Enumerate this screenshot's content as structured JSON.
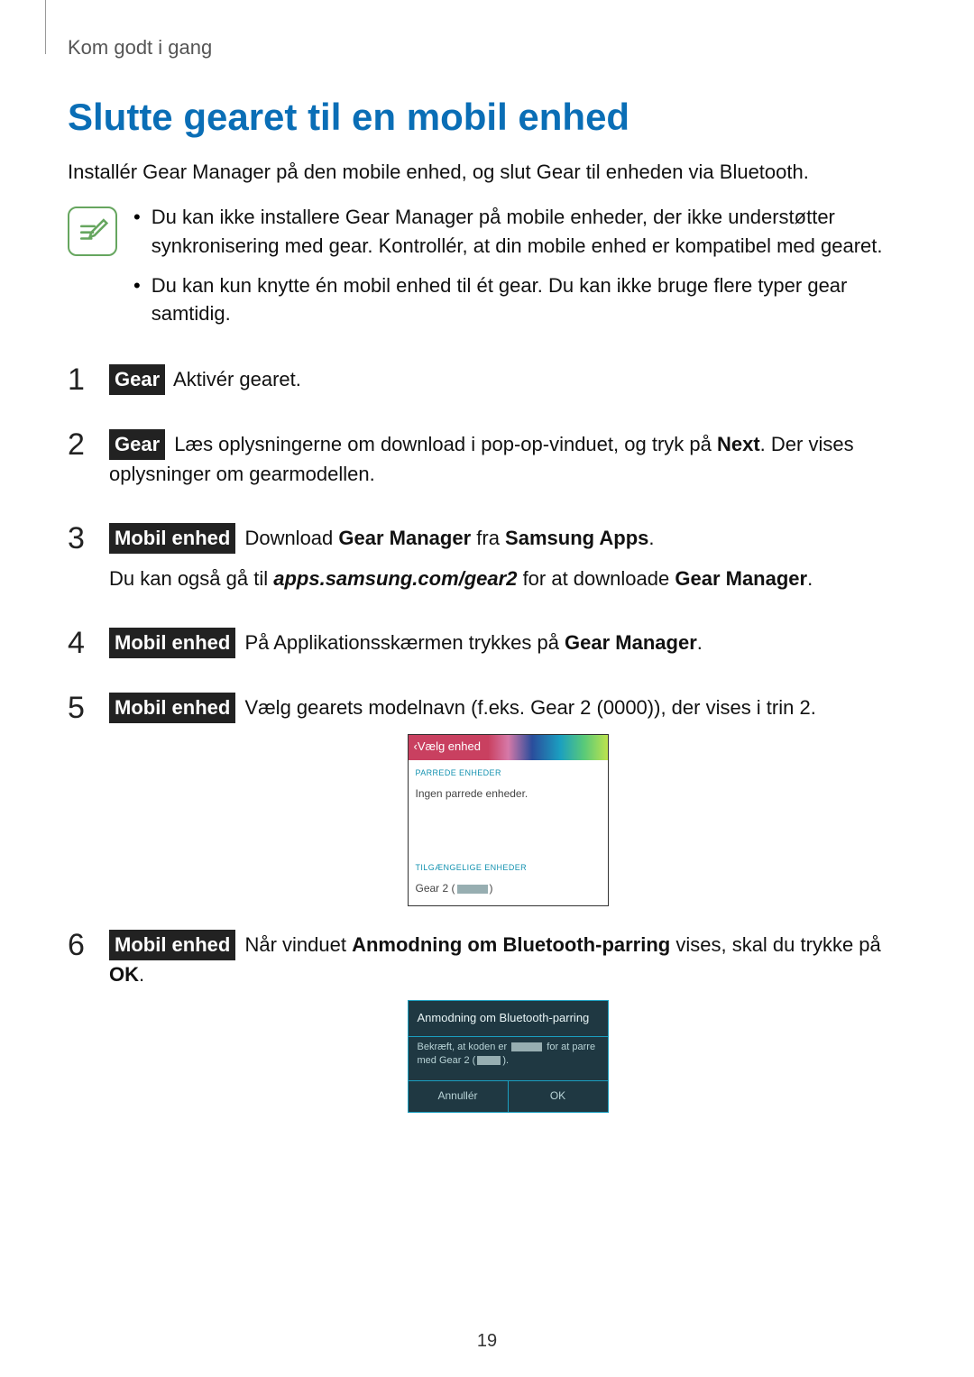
{
  "header": "Kom godt i gang",
  "title": "Slutte gearet til en mobil enhed",
  "intro": "Installér Gear Manager på den mobile enhed, og slut Gear til enheden via Bluetooth.",
  "note_icon": "notes-pencil-icon",
  "notes": [
    "Du kan ikke installere Gear Manager på mobile enheder, der ikke understøtter synkronisering med gear. Kontrollér, at din mobile enhed er kompatibel med gearet.",
    "Du kan kun knytte én mobil enhed til ét gear. Du kan ikke bruge flere typer gear samtidig."
  ],
  "tags": {
    "gear": "Gear",
    "mobile": "Mobil enhed"
  },
  "steps": {
    "s1": {
      "num": "1",
      "text": " Aktivér gearet."
    },
    "s2": {
      "num": "2",
      "t1": " Læs oplysningerne om download i pop-op-vinduet, og tryk på ",
      "b1": "Next",
      "t2": ". Der vises oplysninger om gearmodellen."
    },
    "s3": {
      "num": "3",
      "t1": " Download ",
      "b1": "Gear Manager",
      "t2": " fra ",
      "b2": "Samsung Apps",
      "t3": ".",
      "p2a": "Du kan også gå til ",
      "link": "apps.samsung.com/gear2",
      "p2b": " for at downloade ",
      "b3": "Gear Manager",
      "p2c": "."
    },
    "s4": {
      "num": "4",
      "t1": " På Applikationsskærmen trykkes på ",
      "b1": "Gear Manager",
      "t2": "."
    },
    "s5": {
      "num": "5",
      "t1": " Vælg gearets modelnavn (f.eks. Gear 2 (0000)), der vises i trin 2."
    },
    "s6": {
      "num": "6",
      "t1": " Når vinduet ",
      "b1": "Anmodning om Bluetooth-parring",
      "t2": " vises, skal du trykke på ",
      "b2": "OK",
      "t3": "."
    }
  },
  "device_screen": {
    "title_chevron": "‹ ",
    "title": "Vælg enhed",
    "paired_label": "PARREDE ENHEDER",
    "paired_none": "Ingen parrede enheder.",
    "available_label": "TILGÆNGELIGE ENHEDER",
    "available_pre": "Gear 2 (",
    "available_post": ")"
  },
  "dialog": {
    "title": "Anmodning om Bluetooth-parring",
    "body_a": "Bekræft, at koden er ",
    "body_b": " for at parre med Gear 2 (",
    "body_c": ").",
    "cancel": "Annullér",
    "ok": "OK"
  },
  "page_number": "19"
}
